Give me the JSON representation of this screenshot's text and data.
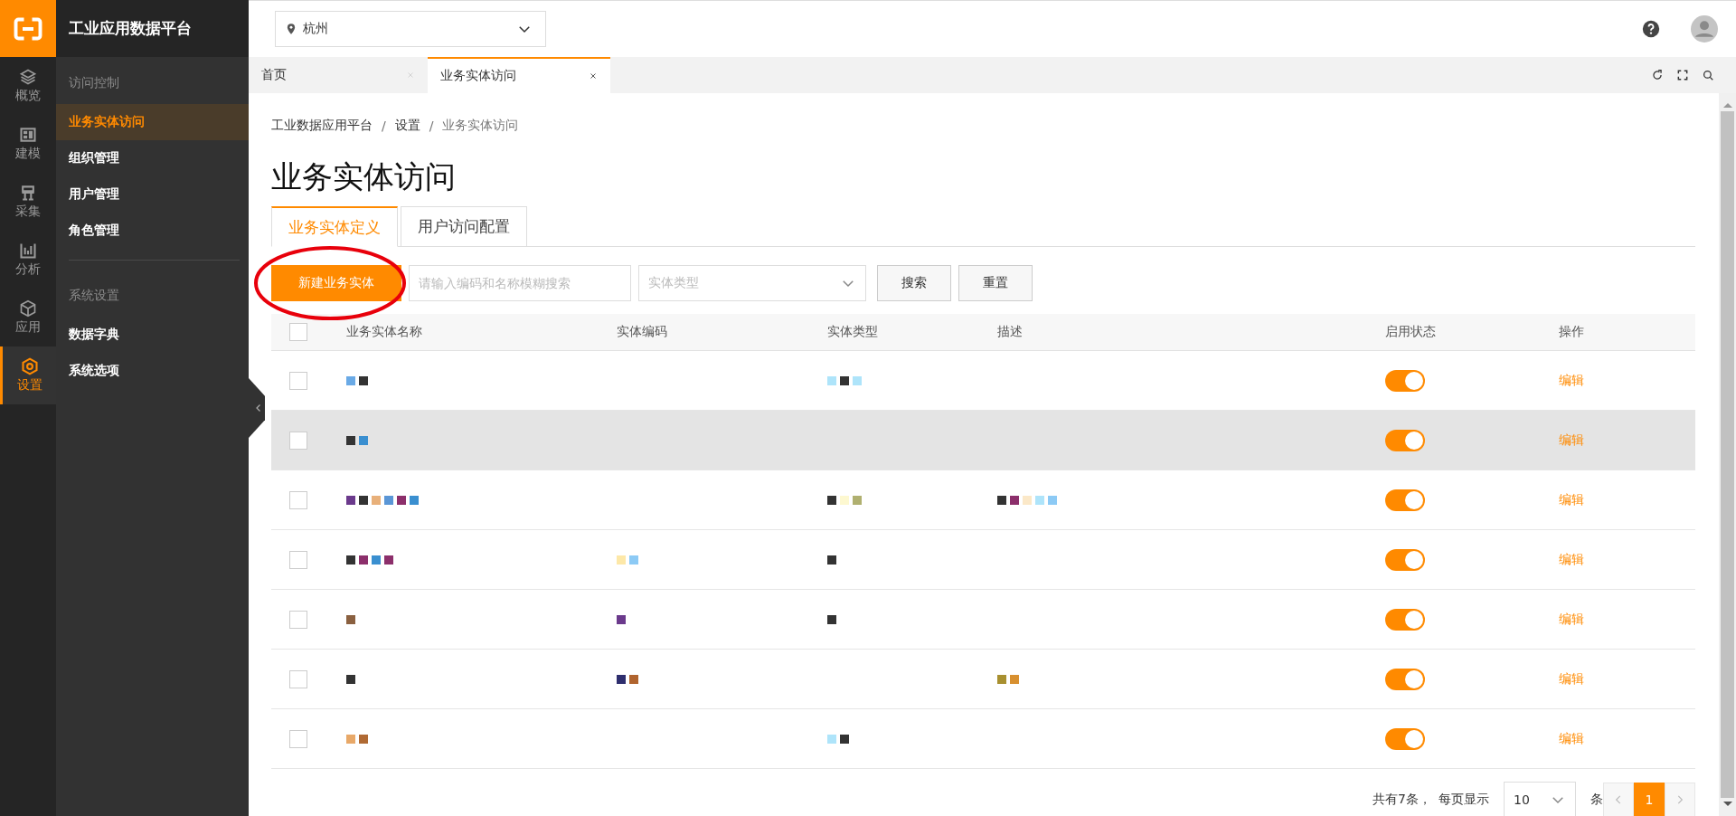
{
  "logo": {
    "title": "工业应用数据平台"
  },
  "rail": [
    {
      "label": "概览",
      "kind": "layers",
      "selected": false
    },
    {
      "label": "建模",
      "kind": "grid",
      "selected": false
    },
    {
      "label": "采集",
      "kind": "network",
      "selected": false
    },
    {
      "label": "分析",
      "kind": "chart",
      "selected": false
    },
    {
      "label": "应用",
      "kind": "cube",
      "selected": false
    },
    {
      "label": "设置",
      "kind": "settings",
      "selected": true
    }
  ],
  "sidebar": {
    "groups": [
      {
        "title": "访问控制",
        "items": [
          {
            "label": "业务实体访问",
            "selected": true
          },
          {
            "label": "组织管理",
            "selected": false
          },
          {
            "label": "用户管理",
            "selected": false
          },
          {
            "label": "角色管理",
            "selected": false
          }
        ]
      },
      {
        "title": "系统设置",
        "items": [
          {
            "label": "数据字典",
            "selected": false
          },
          {
            "label": "系统选项",
            "selected": false
          }
        ]
      }
    ]
  },
  "location": {
    "value": "杭州"
  },
  "page_tabs": [
    {
      "label": "首页",
      "selected": false
    },
    {
      "label": "业务实体访问",
      "selected": true
    }
  ],
  "breadcrumb": [
    {
      "kind": "link",
      "text": "工业数据应用平台"
    },
    {
      "kind": "separator",
      "text": "/"
    },
    {
      "kind": "link",
      "text": "设置"
    },
    {
      "kind": "separator",
      "text": "/"
    },
    {
      "kind": "current",
      "text": "业务实体访问"
    }
  ],
  "title": "业务实体访问",
  "content_tabs": [
    {
      "label": "业务实体定义",
      "selected": true
    },
    {
      "label": "用户访问配置",
      "selected": false
    }
  ],
  "toolbar": {
    "new_button": "新建业务实体",
    "search": {
      "placeholder": "请输入编码和名称模糊搜索"
    },
    "type_select": {
      "placeholder": "实体类型"
    },
    "buttons": [
      "搜索",
      "重置"
    ]
  },
  "table": {
    "header_checked": false,
    "columns": [
      "业务实体名称",
      "实体编码",
      "实体类型",
      "描述",
      "启用状态",
      "操作"
    ],
    "rows": [
      {
        "highlighted": false,
        "checked": false,
        "enabled": true,
        "action": "编辑",
        "name": [
          {
            "color": "#6aaae6"
          },
          {
            "color": "#333333"
          }
        ],
        "type": [
          {
            "color": "#aee4fa"
          },
          {
            "color": "#333333"
          },
          {
            "color": "#aee4fa"
          }
        ]
      },
      {
        "highlighted": true,
        "checked": false,
        "enabled": true,
        "action": "编辑",
        "name": [
          {
            "color": "#333333"
          },
          {
            "color": "#3a8fd0"
          }
        ]
      },
      {
        "highlighted": false,
        "checked": false,
        "enabled": true,
        "action": "编辑",
        "name": [
          {
            "color": "#6b3a8c"
          },
          {
            "color": "#333333"
          },
          {
            "color": "#e8b07a"
          },
          {
            "color": "#5a96d6"
          },
          {
            "color": "#8c2f6b"
          },
          {
            "color": "#3a8fd0"
          }
        ],
        "type": [
          {
            "color": "#333333"
          },
          {
            "color": "#fdf8d0"
          },
          {
            "color": "#b0b070"
          }
        ],
        "description": [
          {
            "color": "#333333"
          },
          {
            "color": "#8c2f6b"
          },
          {
            "color": "#fbe8c8"
          },
          {
            "color": "#aee4fa"
          },
          {
            "color": "#8ccaf5"
          }
        ]
      },
      {
        "highlighted": false,
        "checked": false,
        "enabled": true,
        "action": "编辑",
        "name": [
          {
            "color": "#333333"
          },
          {
            "color": "#8c2f6b"
          },
          {
            "color": "#3a8fd0"
          },
          {
            "color": "#8c2f6b"
          }
        ],
        "code": [
          {
            "color": "#fde8a8"
          },
          {
            "color": "#8ccaf5"
          }
        ],
        "type": [
          {
            "color": "#333333"
          }
        ]
      },
      {
        "highlighted": false,
        "checked": false,
        "enabled": true,
        "action": "编辑",
        "name": [
          {
            "color": "#8a6040"
          }
        ],
        "code": [
          {
            "color": "#6b3a8c"
          }
        ],
        "type": [
          {
            "color": "#333333"
          }
        ]
      },
      {
        "highlighted": false,
        "checked": false,
        "enabled": true,
        "action": "编辑",
        "name": [
          {
            "color": "#333333"
          }
        ],
        "code": [
          {
            "color": "#2e2e6e"
          },
          {
            "color": "#b0642e"
          }
        ],
        "description": [
          {
            "color": "#a89030"
          },
          {
            "color": "#d89030"
          }
        ]
      },
      {
        "highlighted": false,
        "checked": false,
        "enabled": true,
        "action": "编辑",
        "name": [
          {
            "color": "#e8a868"
          },
          {
            "color": "#b06a34"
          }
        ],
        "type": [
          {
            "color": "#aee4fa"
          },
          {
            "color": "#333333"
          }
        ]
      }
    ]
  },
  "pagination": {
    "total": "共有7条，",
    "per_page_label": "每页显示",
    "per_page": "10",
    "unit": "条",
    "pages": [
      {
        "label": "1",
        "selected": true
      }
    ]
  }
}
